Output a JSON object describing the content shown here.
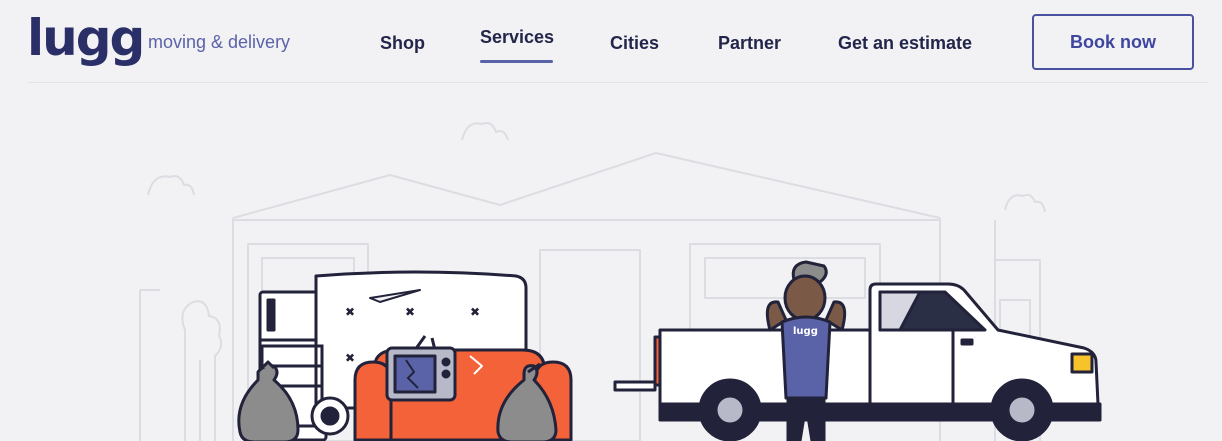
{
  "brand": {
    "logo": "lugg",
    "tagline": "moving & delivery"
  },
  "nav": {
    "items": [
      {
        "label": "Shop",
        "active": false
      },
      {
        "label": "Services",
        "active": true
      },
      {
        "label": "Cities",
        "active": false
      },
      {
        "label": "Partner",
        "active": false
      },
      {
        "label": "Get an estimate",
        "active": false
      }
    ],
    "cta": "Book now"
  },
  "hero": {
    "shirt_text": "lugg"
  },
  "colors": {
    "brand": "#2b2f68",
    "accent": "#5a63a8",
    "sofa": "#f4623a",
    "background": "#f2f2f4"
  }
}
